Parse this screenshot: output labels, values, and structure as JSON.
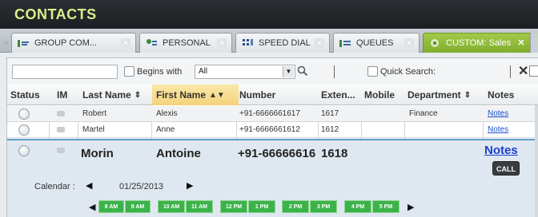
{
  "window": {
    "title": "CONTACTS"
  },
  "tabs": [
    {
      "label": "GROUP COM...",
      "icon": "group-contacts-icon",
      "active": false
    },
    {
      "label": "PERSONAL",
      "icon": "personal-contacts-icon",
      "active": false
    },
    {
      "label": "SPEED DIAL",
      "icon": "speed-dial-icon",
      "active": false
    },
    {
      "label": "QUEUES",
      "icon": "queues-icon",
      "active": false
    },
    {
      "label": "CUSTOM: Sales",
      "icon": "custom-group-icon",
      "active": true
    }
  ],
  "toolbar": {
    "search_value": "",
    "begins_with_label": "Begins with",
    "begins_with_checked": false,
    "field_select_value": "All",
    "quick_search_label": "Quick Search:",
    "quick_search_checked": false
  },
  "columns": [
    "Status",
    "IM",
    "Last Name",
    "First Name",
    "Number",
    "Exten...",
    "Mobile",
    "Department",
    "Notes"
  ],
  "rows": [
    {
      "last_name": "Robert",
      "first_name": "Alexis",
      "number": "+91-6666661617",
      "extension": "1617",
      "mobile": "",
      "department": "Finance",
      "notes": "Notes"
    },
    {
      "last_name": "Martel",
      "first_name": "Anne",
      "number": "+91-6666661612",
      "extension": "1612",
      "mobile": "",
      "department": "",
      "notes": "Notes"
    }
  ],
  "expanded_row": {
    "last_name": "Morin",
    "first_name": "Antoine",
    "number": "+91-66666616",
    "extension": "1618",
    "notes": "Notes",
    "call_label": "CALL",
    "calendar_label": "Calendar :",
    "calendar_date": "01/25/2013",
    "time_slots": [
      "8 AM",
      "9 AM",
      "10 AM",
      "11 AM",
      "12 PM",
      "1 PM",
      "2 PM",
      "3 PM",
      "4 PM",
      "5 PM"
    ]
  },
  "colors": {
    "title_text": "#d8f08a",
    "active_tab": "#8dbb36",
    "link": "#1a4fd0",
    "slot": "#3cb34a"
  }
}
